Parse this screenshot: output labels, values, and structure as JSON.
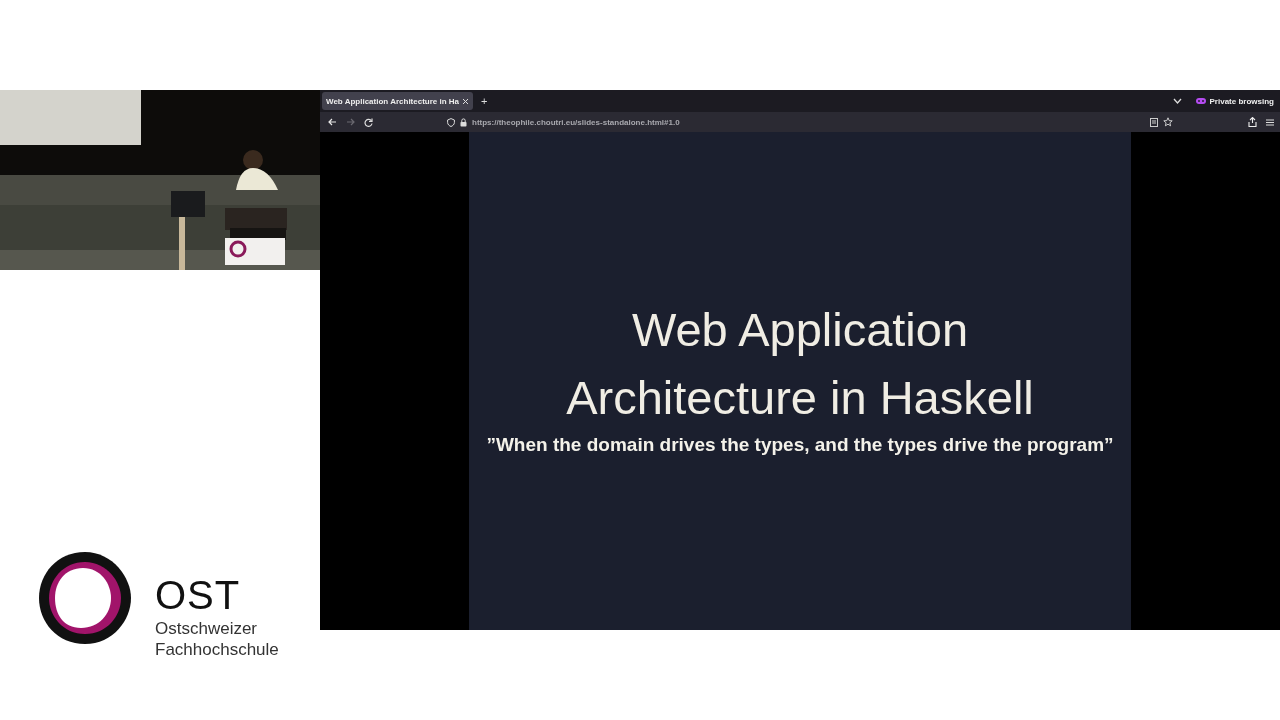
{
  "logo": {
    "name": "OST",
    "lines": [
      "Ostschweizer",
      "Fachhochschule"
    ]
  },
  "browser": {
    "tabs": [
      {
        "title": "Web Application Architecture in Ha",
        "selected": true
      }
    ],
    "new_tab": "+",
    "private_label": "Private browsing",
    "nav": {
      "back_disabled": false,
      "forward_disabled": true
    },
    "url": "https://theophile.**choutri.eu**/slides-standalone.html#1.0"
  },
  "slide": {
    "title": "Web Application Architecture in Haskell",
    "subtitle": "”When the domain drives the types, and the types drive the program”"
  }
}
